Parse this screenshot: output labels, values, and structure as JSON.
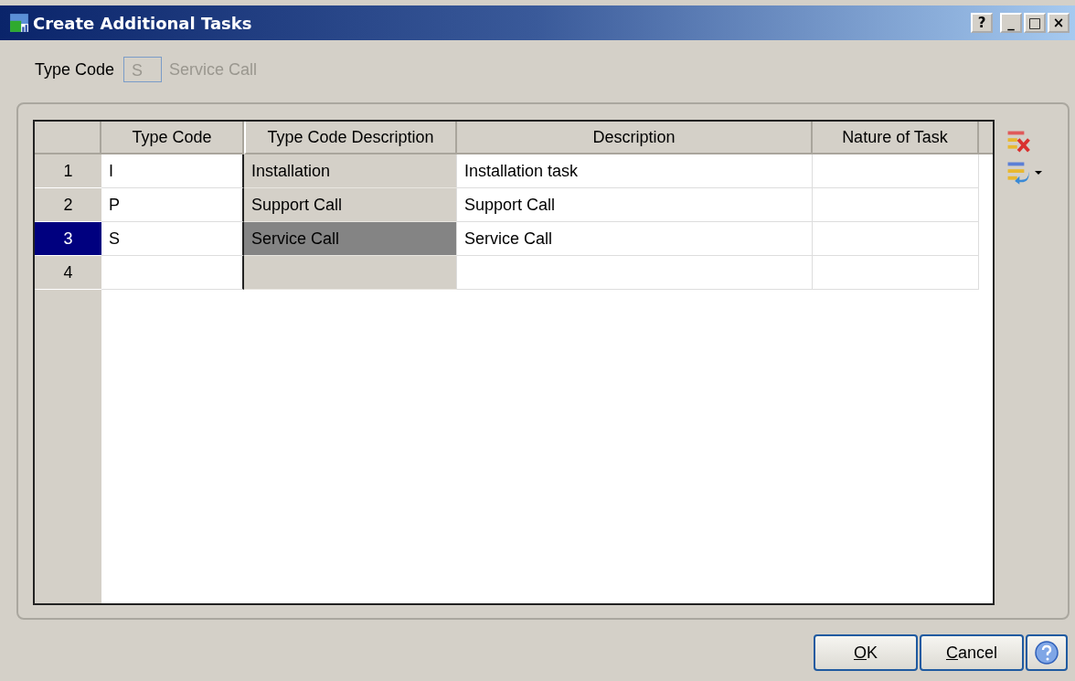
{
  "window": {
    "title": "Create Additional Tasks",
    "controls": [
      "?",
      "_",
      "□",
      "×"
    ]
  },
  "type_code": {
    "label": "Type Code",
    "value": "S",
    "description": "Service Call",
    "disabled": true
  },
  "table": {
    "columns": [
      "Type Code",
      "Type Code Description",
      "Description",
      "Nature of Task"
    ],
    "rows": [
      {
        "number": "1",
        "type_code": "I",
        "type_code_description": "Installation",
        "description": "Installation task",
        "nature_of_task": "",
        "selected": false
      },
      {
        "number": "2",
        "type_code": "P",
        "type_code_description": "Support Call",
        "description": "Support Call",
        "nature_of_task": "",
        "selected": false
      },
      {
        "number": "3",
        "type_code": "S",
        "type_code_description": "Service Call",
        "description": "Service Call",
        "nature_of_task": "",
        "selected": true
      },
      {
        "number": "4",
        "type_code": "",
        "type_code_description": "",
        "description": "",
        "nature_of_task": "",
        "selected": false
      }
    ]
  },
  "buttons": [
    "OK",
    "Cancel"
  ]
}
